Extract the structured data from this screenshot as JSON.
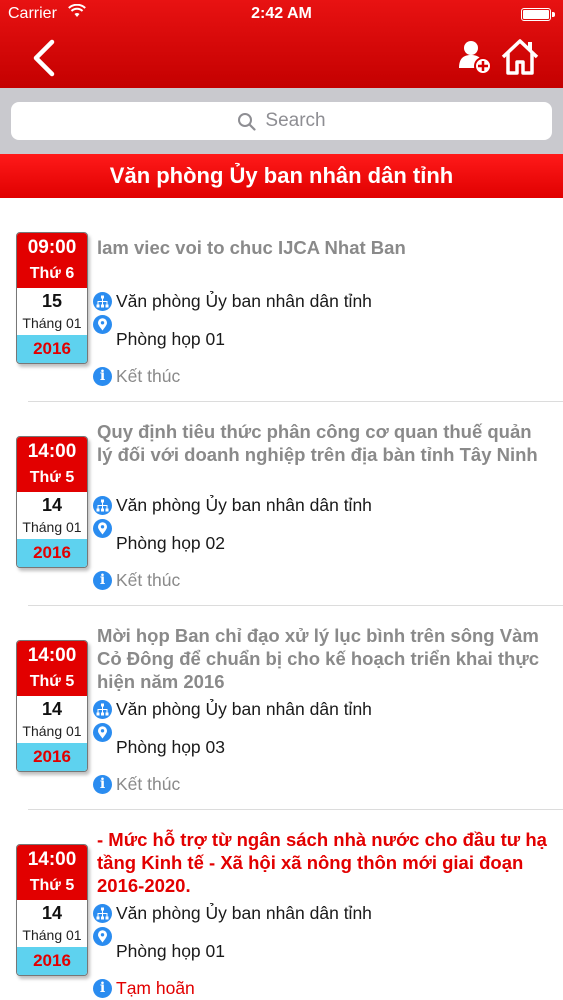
{
  "status_bar": {
    "carrier": "Carrier",
    "time": "2:42 AM"
  },
  "search": {
    "placeholder": "Search"
  },
  "section_title": "Văn phòng Ủy ban nhân dân tỉnh",
  "colors": {
    "header_red": "#e20000",
    "year_cyan": "#5ed2ef",
    "icon_blue": "#2a8cf0",
    "done_gray": "#8a8a8a"
  },
  "icons": [
    "chevron-left-icon",
    "add-user-icon",
    "home-icon",
    "search-icon",
    "org-icon",
    "location-pin-icon",
    "info-icon",
    "wifi-icon",
    "battery-icon"
  ],
  "meetings": [
    {
      "time": "09:00",
      "weekday": "Thứ 6",
      "day": "15",
      "month": "Tháng 01",
      "year": "2016",
      "title": "lam viec voi to chuc IJCA Nhat Ban",
      "organizer": "Văn phòng Ủy ban nhân dân tỉnh",
      "room": "Phòng họp 01",
      "status": "Kết thúc"
    },
    {
      "time": "14:00",
      "weekday": "Thứ 5",
      "day": "14",
      "month": "Tháng 01",
      "year": "2016",
      "title": "Quy định tiêu thức phân công cơ quan thuế quản lý đối với doanh nghiệp trên địa bàn tỉnh Tây Ninh",
      "organizer": "Văn phòng Ủy ban nhân dân tỉnh",
      "room": "Phòng họp 02",
      "status": "Kết thúc"
    },
    {
      "time": "14:00",
      "weekday": "Thứ 5",
      "day": "14",
      "month": "Tháng 01",
      "year": "2016",
      "title": "Mời họp Ban chỉ đạo xử lý lục bình trên sông Vàm Cỏ Đông để chuẩn bị cho kế hoạch triển khai thực hiện năm 2016",
      "organizer": "Văn phòng Ủy ban nhân dân tỉnh",
      "room": "Phòng họp 03",
      "status": "Kết thúc"
    },
    {
      "time": "14:00",
      "weekday": "Thứ 5",
      "day": "14",
      "month": "Tháng 01",
      "year": "2016",
      "title": "- Mức hỗ trợ từ ngân sách nhà nước cho đầu tư hạ tầng Kinh tế - Xã hội xã nông thôn mới giai đoạn 2016-2020.",
      "organizer": "Văn phòng Ủy ban nhân dân tỉnh",
      "room": "Phòng họp 01",
      "status": "Tạm hoãn"
    }
  ]
}
